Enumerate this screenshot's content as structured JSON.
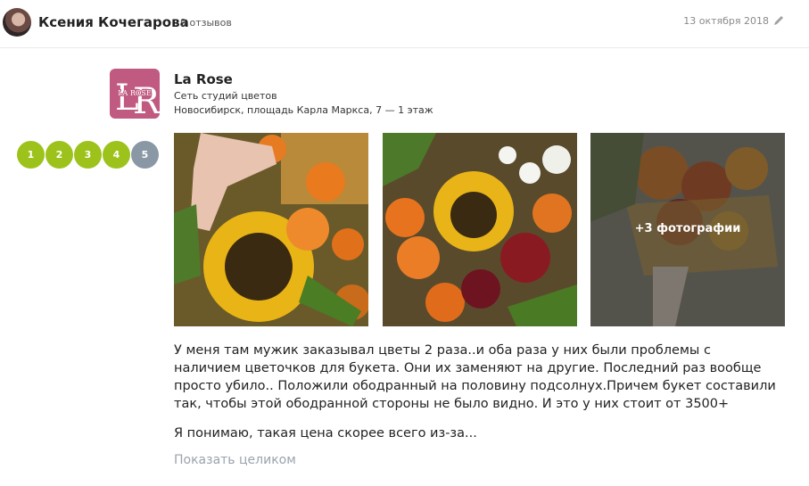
{
  "header": {
    "author_name": "Ксения Кочегарова",
    "reviews_count": "9 отзывов",
    "date": "13 октября 2018",
    "avatar_icon": "user-avatar",
    "edit_icon": "pencil-icon"
  },
  "business": {
    "logo_text": "LA ROSE",
    "logo_letters_left": "L",
    "logo_letters_right": "R",
    "name": "La Rose",
    "type": "Сеть студий цветов",
    "address": "Новосибирск, площадь Карла Маркса, 7 — 1 этаж",
    "logo_color": "#c05a80"
  },
  "rating": {
    "value": 4,
    "max": 5,
    "labels": [
      "1",
      "2",
      "3",
      "4",
      "5"
    ],
    "active_color": "#9dc21c",
    "inactive_color": "#8a97a5"
  },
  "photos": {
    "more_label": "+3 фотографии"
  },
  "review": {
    "text": "У меня там мужик заказывал цветы 2 раза..и оба раза у них были проблемы с наличием цветочков для букета. Они их заменяют на другие. Последний раз вообще просто убило.. Положили ободранный на половину подсолнух.Причем букет составили так, чтобы этой ободранной стороны не было видно. И это у них стоит от 3500+",
    "text2": "Я понимаю, такая цена скорее всего из-за...",
    "show_more": "Показать целиком"
  }
}
